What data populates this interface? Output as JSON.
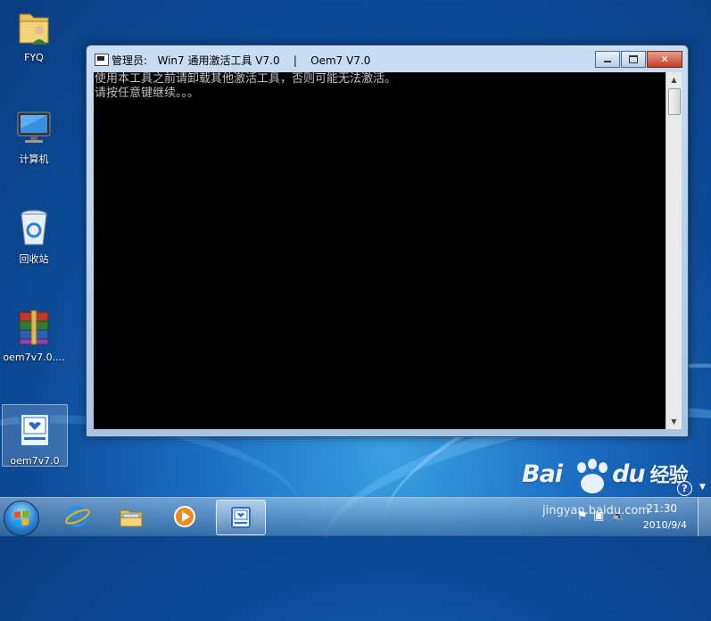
{
  "desktop": {
    "icons": [
      {
        "label": "FYQ",
        "icon": "user-folder-icon"
      },
      {
        "label": "计算机",
        "icon": "computer-icon"
      },
      {
        "label": "回收站",
        "icon": "recycle-bin-icon"
      },
      {
        "label": "oem7v7.0....",
        "icon": "winrar-archive-icon"
      },
      {
        "label": "oem7v7.0",
        "icon": "oem7-app-icon"
      }
    ]
  },
  "window": {
    "title": "管理员:   Win7 通用激活工具 V7.0    |    Oem7 V7.0",
    "lines": [
      "使用本工具之前请卸载其他激活工具，否则可能无法激活。",
      "请按任意键继续。。。"
    ]
  },
  "taskbar": {
    "items": [
      "internet-explorer-icon",
      "windows-explorer-icon",
      "media-player-icon",
      "oem7-app-icon"
    ],
    "time": "21:30",
    "date": "2010/9/4"
  },
  "watermark": {
    "logo_left": "Bai",
    "logo_right": "du",
    "logo_cn": "经验",
    "url": "jingyan.baidu.com"
  },
  "colors": {
    "console_bg": "#000000",
    "console_text": "#c0c0c0",
    "close_button": "#c43a22",
    "desktop_blue": "#1a6cc0"
  }
}
